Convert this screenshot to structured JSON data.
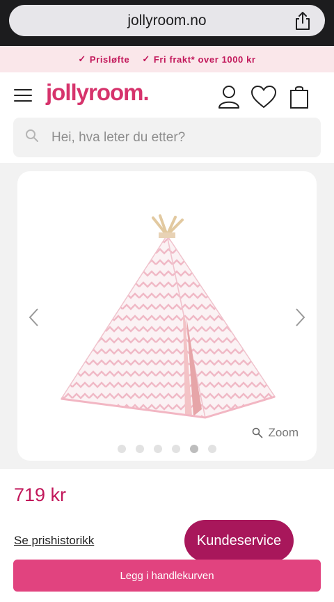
{
  "browser": {
    "url": "jollyroom.no",
    "share_icon": "share-icon"
  },
  "usp": [
    {
      "icon": "check-icon",
      "label": "Prisløfte"
    },
    {
      "icon": "check-icon",
      "label": "Fri frakt* over 1000 kr"
    }
  ],
  "header": {
    "logo": "jollyroom.",
    "icons": [
      "menu-icon",
      "account-icon",
      "heart-icon",
      "bag-icon"
    ],
    "search_placeholder": "Hei, hva leter du etter?"
  },
  "gallery": {
    "zoom_label": "Zoom",
    "image_count": 6,
    "active_index": 4
  },
  "product": {
    "price": "719 kr",
    "price_history_link": "Se prishistorikk",
    "add_to_cart": "Legg i handlekurven"
  },
  "support": {
    "label": "Kundeservice"
  },
  "colors": {
    "brand": "#d6336c",
    "cart_button": "#e1437f",
    "support_button": "#a8175b",
    "usp_bg": "#fae7ea"
  }
}
